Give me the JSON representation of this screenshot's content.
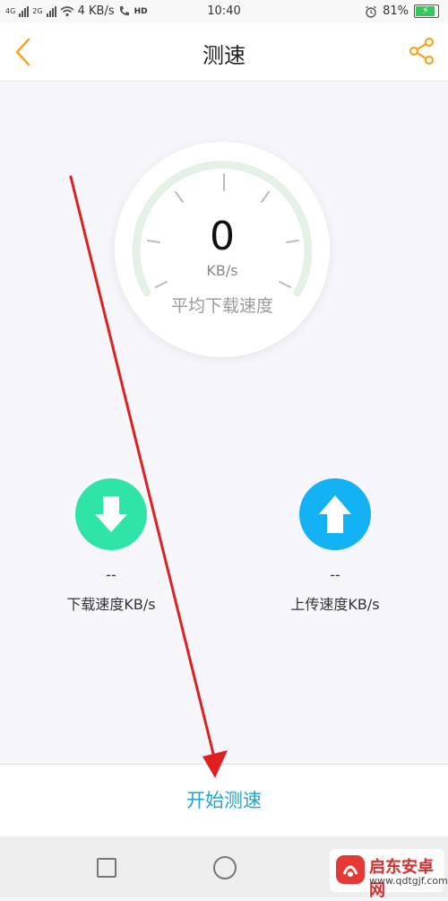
{
  "status_bar": {
    "network_4g": "4G",
    "network_2g": "2G",
    "speed": "4 KB/s",
    "hd": "HD",
    "time": "10:40",
    "battery": "81%"
  },
  "header": {
    "title": "测速"
  },
  "gauge": {
    "value": "0",
    "unit": "KB/s",
    "label": "平均下载速度"
  },
  "download": {
    "value": "--",
    "label": "下载速度KB/s"
  },
  "upload": {
    "value": "--",
    "label": "上传速度KB/s"
  },
  "start_button": {
    "label": "开始测速"
  },
  "watermark": {
    "brand": "启东安卓网",
    "url": "www.qdtgjf.com"
  },
  "colors": {
    "accent": "#1fa5d6",
    "header_icons": "#f5a623",
    "download": "#2ee4a6",
    "upload": "#12b2f4",
    "annotation": "#e02020"
  },
  "icons": {
    "back": "chevron-left-icon",
    "share": "share-icon",
    "download": "arrow-down-icon",
    "upload": "arrow-up-icon"
  }
}
